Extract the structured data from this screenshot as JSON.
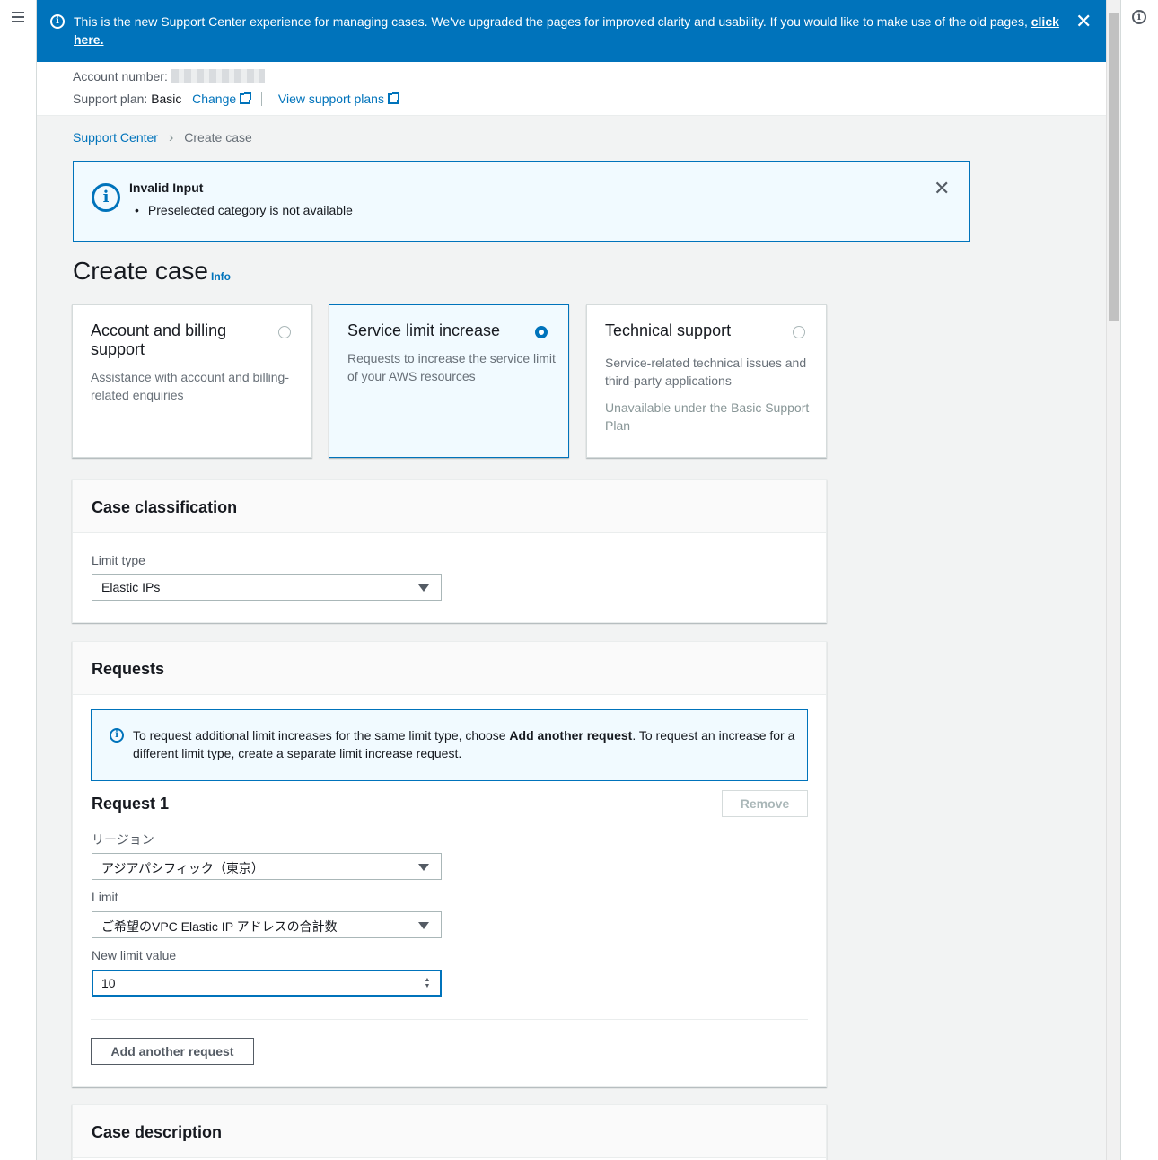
{
  "flash": {
    "message": "This is the new Support Center experience for managing cases. We've upgraded the pages for improved clarity and usability. If you would like to make use of the old pages, ",
    "link": "click here."
  },
  "account": {
    "number_label": "Account number:",
    "plan_label": "Support plan:",
    "plan_value": "Basic",
    "change_link": "Change",
    "view_plans_link": "View support plans"
  },
  "breadcrumb": {
    "root": "Support Center",
    "current": "Create case"
  },
  "alert": {
    "title": "Invalid Input",
    "item": "Preselected category is not available"
  },
  "page": {
    "title": "Create case",
    "info": "Info"
  },
  "tiles": [
    {
      "title": "Account and billing support",
      "desc": "Assistance with account and billing-related enquiries",
      "note": "",
      "selected": false
    },
    {
      "title": "Service limit increase",
      "desc": "Requests to increase the service limit of your AWS resources",
      "note": "",
      "selected": true
    },
    {
      "title": "Technical support",
      "desc": "Service-related technical issues and third-party applications",
      "note": "Unavailable under the Basic Support Plan",
      "selected": false
    }
  ],
  "classification": {
    "title": "Case classification",
    "limit_type_label": "Limit type",
    "limit_type_value": "Elastic IPs"
  },
  "requests": {
    "title": "Requests",
    "info_pre": "To request additional limit increases for the same limit type, choose ",
    "info_bold": "Add another request",
    "info_post": ". To request an increase for a different limit type, create a separate limit increase request.",
    "request_heading": "Request 1",
    "remove_label": "Remove",
    "region_label": "リージョン",
    "region_value": "アジアパシフィック（東京）",
    "limit_label": "Limit",
    "limit_value": "ご希望のVPC Elastic IP アドレスの合計数",
    "new_value_label": "New limit value",
    "new_value": "10",
    "add_label": "Add another request"
  },
  "description": {
    "title": "Case description"
  },
  "colors": {
    "accent": "#0073bb",
    "banner": "#0073bb",
    "background": "#f2f3f3"
  }
}
